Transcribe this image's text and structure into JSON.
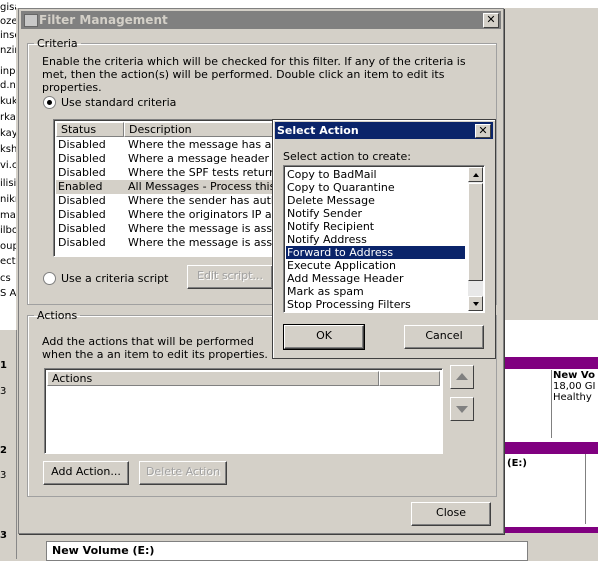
{
  "background": {
    "left_fragments": [
      "gisayar.com.tr",
      "oze",
      "inse",
      "nzin",
      "inpr",
      "d.n",
      "kuk",
      "rka",
      "kay",
      "ksh",
      "vi.c",
      "ilisin",
      "nikn",
      "mai",
      "ilbo",
      "oup",
      "ect",
      "cs",
      "S A"
    ],
    "left_numbers": [
      "1",
      "3",
      "2",
      "3",
      "3"
    ],
    "disk_top": {
      "name": "New Vo",
      "size": "18,00 GI",
      "status": "Healthy"
    },
    "disk_mid": {
      "label": "(E:)"
    },
    "disk_bottom": {
      "label": "New Volume  (E:)"
    },
    "colors": {
      "partition": "#800080"
    }
  },
  "filter_dialog": {
    "title": "Filter Management",
    "close": "✕",
    "criteria": {
      "legend": "Criteria",
      "description": "Enable the criteria which will be checked for this filter. If any of the criteria is met, then the action(s) will be performed. Double click an item to edit its properties.",
      "use_standard": "Use standard criteria",
      "columns": [
        "Status",
        "Description"
      ],
      "rows": [
        {
          "status": "Disabled",
          "desc": "Where the message has an att"
        },
        {
          "status": "Disabled",
          "desc": "Where a message header con"
        },
        {
          "status": "Disabled",
          "desc": "Where the SPF tests return res"
        },
        {
          "status": "Enabled",
          "desc": "All Messages - Process this filte"
        },
        {
          "status": "Disabled",
          "desc": "Where the sender has authent"
        },
        {
          "status": "Disabled",
          "desc": "Where the originators IP addre"
        },
        {
          "status": "Disabled",
          "desc": "Where the message is associa"
        },
        {
          "status": "Disabled",
          "desc": "Where the message is associa"
        }
      ],
      "use_script": "Use a criteria script",
      "edit_script": "Edit script..."
    },
    "actions": {
      "legend": "Actions",
      "description": "Add the actions that will be performed when the a an item to edit its properties.",
      "column": "Actions",
      "add": "Add Action...",
      "delete": "Delete Action"
    },
    "close_button": "Close"
  },
  "select_action": {
    "title": "Select Action",
    "close": "✕",
    "prompt": "Select action to create:",
    "items": [
      "Copy to BadMail",
      "Copy to Quarantine",
      "Delete Message",
      "Notify Sender",
      "Notify Recipient",
      "Notify Address",
      "Forward to Address",
      "Execute Application",
      "Add Message Header",
      "Mark as spam",
      "Stop Processing Filters"
    ],
    "selected_index": 6,
    "ok": "OK",
    "cancel": "Cancel"
  }
}
